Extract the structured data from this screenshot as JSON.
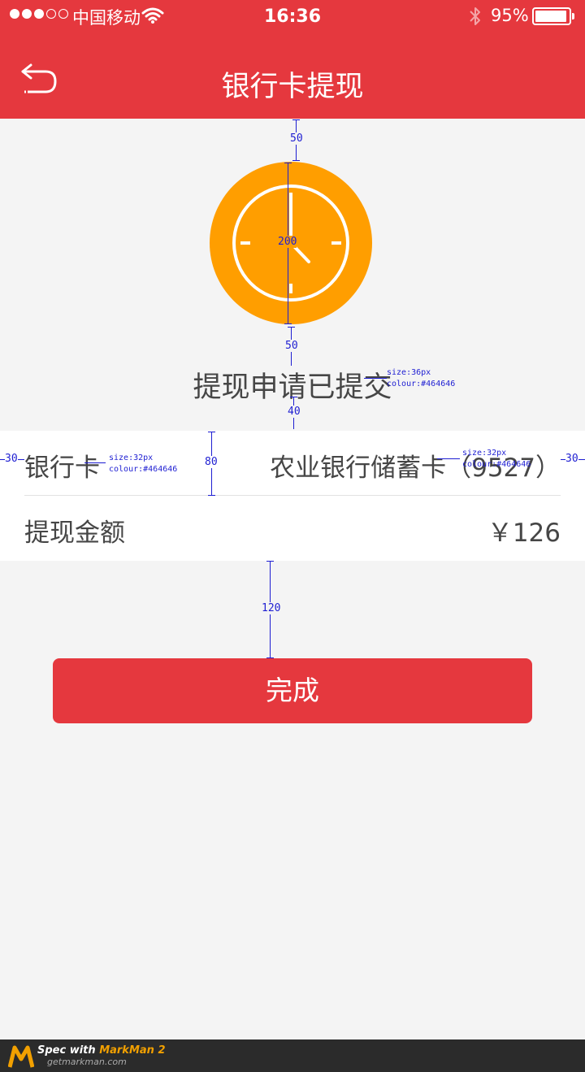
{
  "status_bar": {
    "carrier": "中国移动",
    "time": "16:36",
    "battery": "95%",
    "battery_level": 0.95
  },
  "nav": {
    "title": "银行卡提现",
    "back_icon": "back-arrow-icon"
  },
  "result": {
    "icon": "clock-icon",
    "message": "提现申请已提交"
  },
  "details": [
    {
      "label": "银行卡",
      "value": "农业银行储蓄卡（9527）"
    },
    {
      "label": "提现金额",
      "value": "￥126"
    }
  ],
  "done_button": "完成",
  "annotations": {
    "top_gap": "50",
    "icon_size": "200",
    "icon_gap": "50",
    "text_gap": "40",
    "row_height": "80",
    "left_padding": "30",
    "right_padding": "30",
    "button_gap": "120",
    "title_note": "size:36px\ncolour:#464646",
    "label_note": "size:32px\ncolour:#464646",
    "value_note": "size:32px\ncolour:#464646"
  },
  "footer": {
    "brand_prefix": "Spec with ",
    "brand_name": "MarkMan 2",
    "site": "getmarkman.com"
  },
  "colors": {
    "brand_red": "#e5383e",
    "clock_orange": "#ff9e00",
    "text": "#464646",
    "background": "#f4f4f4",
    "annotation": "#1e1ed2"
  }
}
